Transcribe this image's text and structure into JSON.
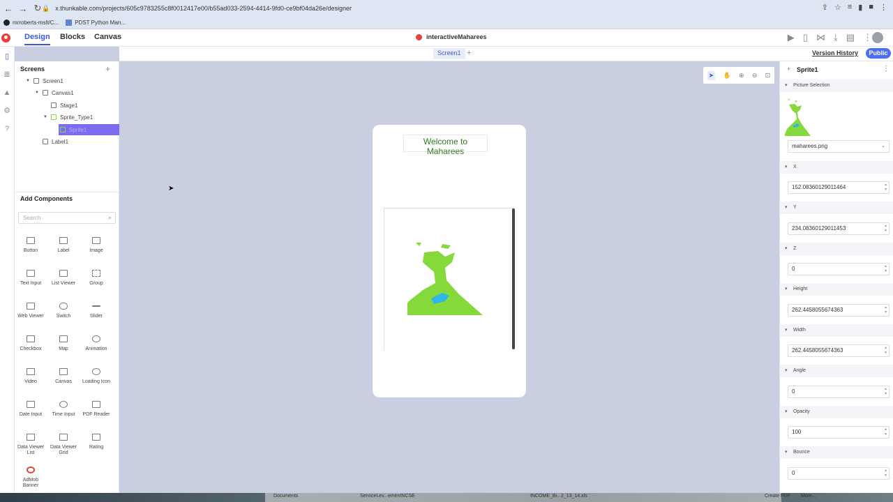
{
  "browser": {
    "url": "x.thunkable.com/projects/605c9783255c8f0012417e00/b55ad033-2594-4414-9fd0-ce9bf04da26e/designer",
    "bookmarks": [
      "mrroberts-mslt/C...",
      "PDST Python Man..."
    ]
  },
  "app": {
    "tabs": [
      "Design",
      "Blocks",
      "Canvas"
    ],
    "active_tab": "Design",
    "project_title": "interactiveMaharees",
    "screen_tab": "Screen1",
    "version_history": "Version History",
    "public_label": "Public",
    "accent": "#3b5bdb"
  },
  "screens_panel": {
    "title": "Screens",
    "tree": [
      {
        "label": "Screen1",
        "icon": "phone-icon"
      },
      {
        "label": "Canvas1",
        "icon": "canvas-icon"
      },
      {
        "label": "Stage1",
        "icon": "stage-icon"
      },
      {
        "label": "Sprite_Type1",
        "icon": "sprite-type-icon"
      },
      {
        "label": "Sprite1",
        "icon": "sprite-icon",
        "selected": true
      },
      {
        "label": "Label1",
        "icon": "label-icon"
      }
    ]
  },
  "components": {
    "title": "Add Components",
    "search_placeholder": "Search",
    "items": [
      "Button",
      "Label",
      "Image",
      "Text Input",
      "List Viewer",
      "Group",
      "Web Viewer",
      "Switch",
      "Slider",
      "Checkbox",
      "Map",
      "Animation",
      "Video",
      "Canvas",
      "Loading Icon",
      "Date Input",
      "Time Input",
      "PDF Reader",
      "Data Viewer List",
      "Data Viewer Grid",
      "Rating",
      "AdMob Banner"
    ]
  },
  "phone": {
    "label_text": "Welcome to Maharees",
    "label_color": "#2e7d1a",
    "sprite_color": "#86d93a",
    "water_color": "#2fb7e8"
  },
  "properties": {
    "title": "Sprite1",
    "picture_section": "Picture Selection",
    "picture_value": "maharees.png",
    "fields": [
      {
        "label": "X",
        "value": "152.08360129011464"
      },
      {
        "label": "Y",
        "value": "234.08360129011453"
      },
      {
        "label": "Z",
        "value": "0"
      },
      {
        "label": "Height",
        "value": "262.4458055674363"
      },
      {
        "label": "Width",
        "value": "262.4458055674363"
      },
      {
        "label": "Angle",
        "value": "0"
      },
      {
        "label": "Opacity",
        "value": "100"
      },
      {
        "label": "Bounce",
        "value": "0"
      }
    ]
  },
  "taskbar": {
    "items": [
      "Documents",
      "ServiceLev...ementNCSE",
      "INCOME_Bi...2_13_14.xls",
      "Create PDF",
      "More..."
    ]
  }
}
